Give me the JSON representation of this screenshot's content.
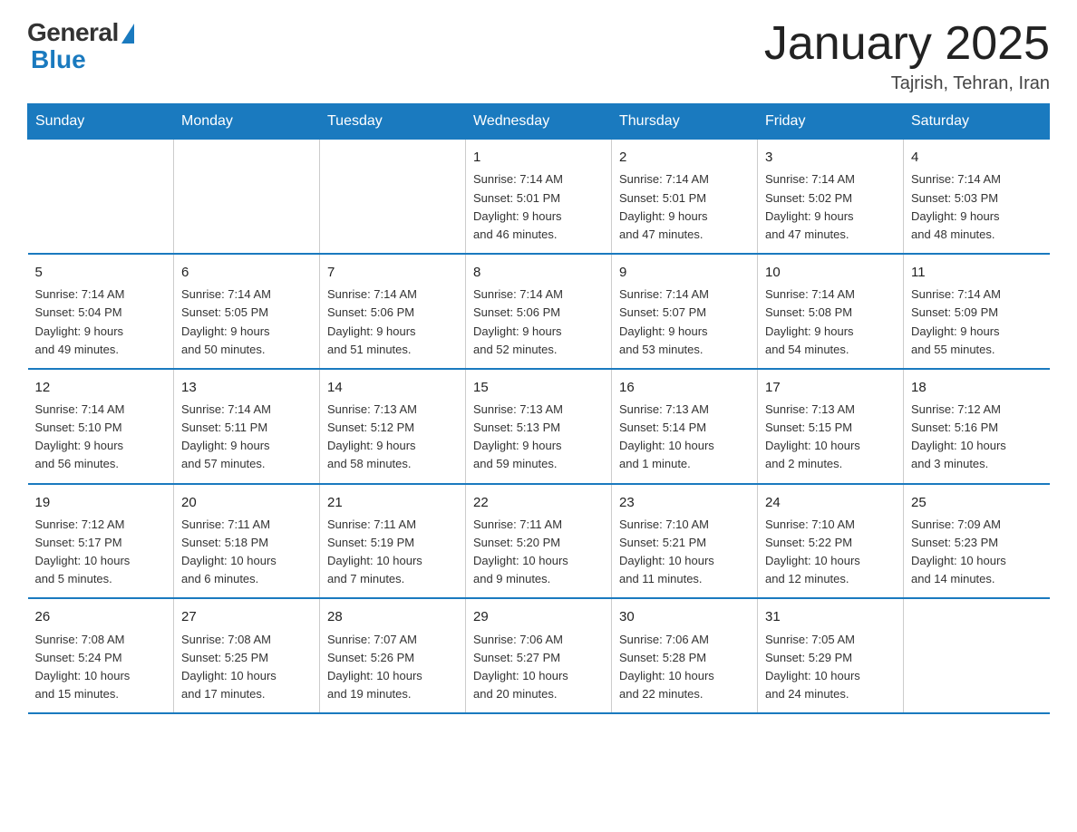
{
  "header": {
    "logo_general": "General",
    "logo_blue": "Blue",
    "month_title": "January 2025",
    "location": "Tajrish, Tehran, Iran"
  },
  "weekdays": [
    "Sunday",
    "Monday",
    "Tuesday",
    "Wednesday",
    "Thursday",
    "Friday",
    "Saturday"
  ],
  "weeks": [
    [
      {
        "day": "",
        "info": ""
      },
      {
        "day": "",
        "info": ""
      },
      {
        "day": "",
        "info": ""
      },
      {
        "day": "1",
        "info": "Sunrise: 7:14 AM\nSunset: 5:01 PM\nDaylight: 9 hours\nand 46 minutes."
      },
      {
        "day": "2",
        "info": "Sunrise: 7:14 AM\nSunset: 5:01 PM\nDaylight: 9 hours\nand 47 minutes."
      },
      {
        "day": "3",
        "info": "Sunrise: 7:14 AM\nSunset: 5:02 PM\nDaylight: 9 hours\nand 47 minutes."
      },
      {
        "day": "4",
        "info": "Sunrise: 7:14 AM\nSunset: 5:03 PM\nDaylight: 9 hours\nand 48 minutes."
      }
    ],
    [
      {
        "day": "5",
        "info": "Sunrise: 7:14 AM\nSunset: 5:04 PM\nDaylight: 9 hours\nand 49 minutes."
      },
      {
        "day": "6",
        "info": "Sunrise: 7:14 AM\nSunset: 5:05 PM\nDaylight: 9 hours\nand 50 minutes."
      },
      {
        "day": "7",
        "info": "Sunrise: 7:14 AM\nSunset: 5:06 PM\nDaylight: 9 hours\nand 51 minutes."
      },
      {
        "day": "8",
        "info": "Sunrise: 7:14 AM\nSunset: 5:06 PM\nDaylight: 9 hours\nand 52 minutes."
      },
      {
        "day": "9",
        "info": "Sunrise: 7:14 AM\nSunset: 5:07 PM\nDaylight: 9 hours\nand 53 minutes."
      },
      {
        "day": "10",
        "info": "Sunrise: 7:14 AM\nSunset: 5:08 PM\nDaylight: 9 hours\nand 54 minutes."
      },
      {
        "day": "11",
        "info": "Sunrise: 7:14 AM\nSunset: 5:09 PM\nDaylight: 9 hours\nand 55 minutes."
      }
    ],
    [
      {
        "day": "12",
        "info": "Sunrise: 7:14 AM\nSunset: 5:10 PM\nDaylight: 9 hours\nand 56 minutes."
      },
      {
        "day": "13",
        "info": "Sunrise: 7:14 AM\nSunset: 5:11 PM\nDaylight: 9 hours\nand 57 minutes."
      },
      {
        "day": "14",
        "info": "Sunrise: 7:13 AM\nSunset: 5:12 PM\nDaylight: 9 hours\nand 58 minutes."
      },
      {
        "day": "15",
        "info": "Sunrise: 7:13 AM\nSunset: 5:13 PM\nDaylight: 9 hours\nand 59 minutes."
      },
      {
        "day": "16",
        "info": "Sunrise: 7:13 AM\nSunset: 5:14 PM\nDaylight: 10 hours\nand 1 minute."
      },
      {
        "day": "17",
        "info": "Sunrise: 7:13 AM\nSunset: 5:15 PM\nDaylight: 10 hours\nand 2 minutes."
      },
      {
        "day": "18",
        "info": "Sunrise: 7:12 AM\nSunset: 5:16 PM\nDaylight: 10 hours\nand 3 minutes."
      }
    ],
    [
      {
        "day": "19",
        "info": "Sunrise: 7:12 AM\nSunset: 5:17 PM\nDaylight: 10 hours\nand 5 minutes."
      },
      {
        "day": "20",
        "info": "Sunrise: 7:11 AM\nSunset: 5:18 PM\nDaylight: 10 hours\nand 6 minutes."
      },
      {
        "day": "21",
        "info": "Sunrise: 7:11 AM\nSunset: 5:19 PM\nDaylight: 10 hours\nand 7 minutes."
      },
      {
        "day": "22",
        "info": "Sunrise: 7:11 AM\nSunset: 5:20 PM\nDaylight: 10 hours\nand 9 minutes."
      },
      {
        "day": "23",
        "info": "Sunrise: 7:10 AM\nSunset: 5:21 PM\nDaylight: 10 hours\nand 11 minutes."
      },
      {
        "day": "24",
        "info": "Sunrise: 7:10 AM\nSunset: 5:22 PM\nDaylight: 10 hours\nand 12 minutes."
      },
      {
        "day": "25",
        "info": "Sunrise: 7:09 AM\nSunset: 5:23 PM\nDaylight: 10 hours\nand 14 minutes."
      }
    ],
    [
      {
        "day": "26",
        "info": "Sunrise: 7:08 AM\nSunset: 5:24 PM\nDaylight: 10 hours\nand 15 minutes."
      },
      {
        "day": "27",
        "info": "Sunrise: 7:08 AM\nSunset: 5:25 PM\nDaylight: 10 hours\nand 17 minutes."
      },
      {
        "day": "28",
        "info": "Sunrise: 7:07 AM\nSunset: 5:26 PM\nDaylight: 10 hours\nand 19 minutes."
      },
      {
        "day": "29",
        "info": "Sunrise: 7:06 AM\nSunset: 5:27 PM\nDaylight: 10 hours\nand 20 minutes."
      },
      {
        "day": "30",
        "info": "Sunrise: 7:06 AM\nSunset: 5:28 PM\nDaylight: 10 hours\nand 22 minutes."
      },
      {
        "day": "31",
        "info": "Sunrise: 7:05 AM\nSunset: 5:29 PM\nDaylight: 10 hours\nand 24 minutes."
      },
      {
        "day": "",
        "info": ""
      }
    ]
  ]
}
